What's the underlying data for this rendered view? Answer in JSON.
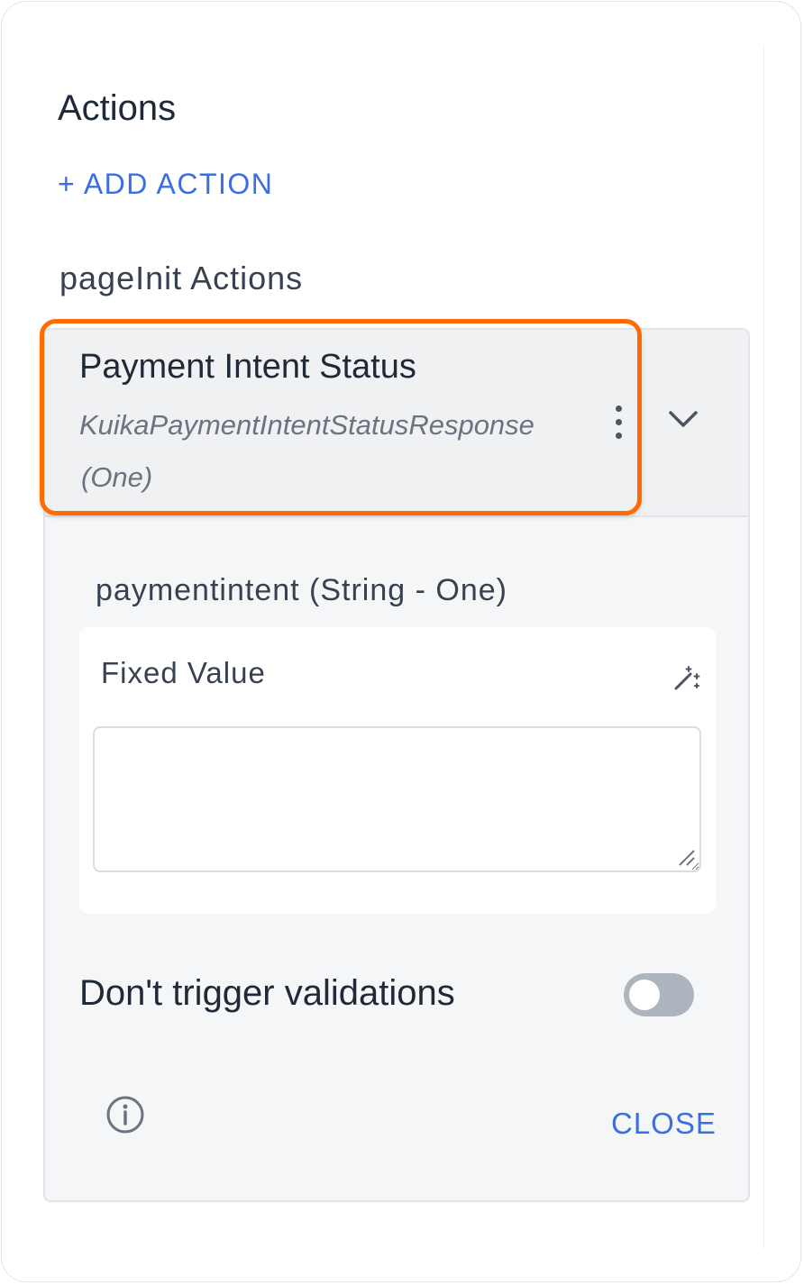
{
  "panel": {
    "title": "Actions",
    "add_action_label": "+ ADD ACTION",
    "section_title": "pageInit Actions"
  },
  "action": {
    "name": "Payment Intent Status",
    "type": "KuikaPaymentIntentStatusResponse",
    "cardinality": "(One)",
    "highlight_color": "#ff6b00"
  },
  "parameter": {
    "label": "paymentintent (String - One)",
    "source_label": "Fixed Value",
    "value": ""
  },
  "options": {
    "dont_trigger_validations_label": "Don't trigger validations",
    "dont_trigger_validations_enabled": false
  },
  "footer": {
    "close_label": "CLOSE"
  },
  "icons": {
    "kebab": "more-vertical-icon",
    "chevron": "chevron-down-icon",
    "wand": "magic-wand-icon",
    "info": "info-icon",
    "grip": "resize-grip-icon"
  },
  "colors": {
    "accent": "#3b6fe0",
    "toggle_off": "#aeb4bd"
  }
}
